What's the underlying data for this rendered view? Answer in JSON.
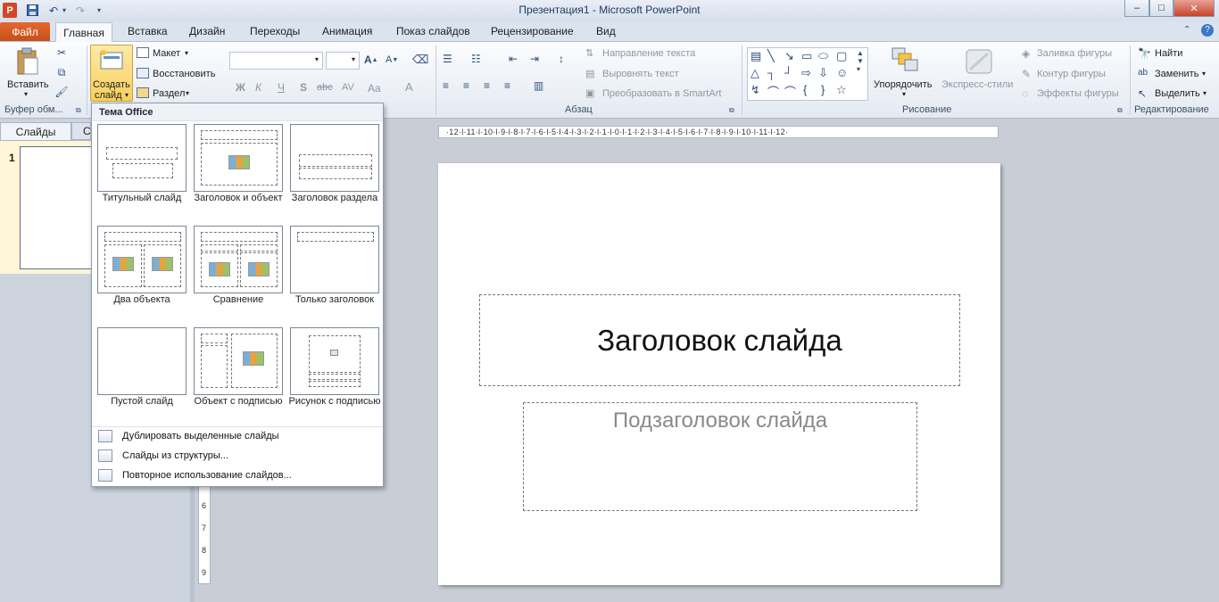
{
  "window": {
    "title": "Презентация1  -  Microsoft PowerPoint"
  },
  "quick_access": {
    "app_letter": "P",
    "undo_glyph": "↶",
    "redo_glyph": "↷"
  },
  "window_controls": {
    "minimize": "–",
    "maximize": "□",
    "close": "✕"
  },
  "tabs": {
    "file": "Файл",
    "home": "Главная",
    "insert": "Вставка",
    "design": "Дизайн",
    "transitions": "Переходы",
    "animation": "Анимация",
    "slideshow": "Показ слайдов",
    "review": "Рецензирование",
    "view": "Вид"
  },
  "ribbon": {
    "clipboard": {
      "paste": "Вставить",
      "label": "Буфер обм..."
    },
    "slides": {
      "new_slide_line1": "Создать",
      "new_slide_line2": "слайд",
      "layout": "Макет",
      "reset": "Восстановить",
      "section": "Раздел"
    },
    "paragraph": {
      "text_direction": "Направление текста",
      "align_text": "Выровнять текст",
      "convert_smartart": "Преобразовать в SmartArt",
      "label": "Абзац"
    },
    "drawing": {
      "arrange": "Упорядочить",
      "quick_styles": "Экспресс-стили",
      "shape_fill": "Заливка фигуры",
      "shape_outline": "Контур фигуры",
      "shape_effects": "Эффекты фигуры",
      "label": "Рисование"
    },
    "editing": {
      "find": "Найти",
      "replace": "Заменить",
      "select": "Выделить",
      "label": "Редактирование"
    },
    "font": {
      "bold": "Ж",
      "italic": "К",
      "underline": "Ч",
      "shadow": "S",
      "strike": "abc",
      "spacing": "AV",
      "case": "Aa",
      "color": "A"
    }
  },
  "left_pane": {
    "slides_tab": "Слайды",
    "outline_tab": "С",
    "slide_number": "1"
  },
  "layout_menu": {
    "header": "Тема Office",
    "layouts": [
      "Титульный слайд",
      "Заголовок и объект",
      "Заголовок раздела",
      "Два объекта",
      "Сравнение",
      "Только заголовок",
      "Пустой слайд",
      "Объект с подписью",
      "Рисунок с подписью"
    ],
    "items": [
      "Дублировать выделенные слайды",
      "Слайды из структуры...",
      "Повторное использование слайдов..."
    ]
  },
  "ruler": {
    "horizontal": "·12·l·11·l·10·l·9·l·8·l·7·l·6·l·5·l·4·l·3·l·2·l·1·l·0·l·1·l·2·l·3·l·4·l·5·l·6·l·7·l·8·l·9·l·10·l·11·l·12·",
    "vertical": [
      "6",
      "7",
      "8",
      "9"
    ]
  },
  "slide": {
    "title": "Заголовок слайда",
    "subtitle": "Подзаголовок слайда"
  },
  "colors": {
    "file_tab": "#d45a22",
    "accent": "#1e395b",
    "selected_slide_bg": "#fff5d7"
  }
}
